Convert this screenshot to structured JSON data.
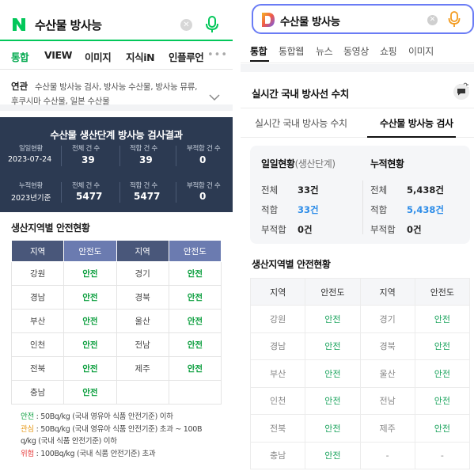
{
  "naver": {
    "search": {
      "query": "수산물 방사능",
      "logo_letter": "N",
      "brand_color": "#03c75a"
    },
    "tabs": [
      "통합",
      "VIEW",
      "이미지",
      "지식iN",
      "인플루언"
    ],
    "related": {
      "label": "연관",
      "line1": "수산물 방사능 검사, 방사능 수산물, 방사능 뮤류,",
      "line2": "후쿠시마 수산물, 일본 수산물"
    },
    "summary": {
      "title": "수산물 생산단계 방사능 검사결과",
      "daily": {
        "label": "일일현황",
        "date": "2023-07-24",
        "total_label": "전체 건 수",
        "total": "39",
        "ok_label": "적합 건 수",
        "ok": "39",
        "fail_label": "부적합 건 수",
        "fail": "0"
      },
      "cumulative": {
        "label": "누적현황",
        "basis": "2023년기준",
        "total_label": "전체 건 수",
        "total": "5477",
        "ok_label": "적합 건 수",
        "ok": "5477",
        "fail_label": "부적합 건 수",
        "fail": "0"
      }
    },
    "region_title": "생산지역별 안전현황",
    "table": {
      "headers": [
        "지역",
        "안전도",
        "지역",
        "안전도"
      ],
      "rows": [
        [
          "강원",
          "안전",
          "경기",
          "안전"
        ],
        [
          "경남",
          "안전",
          "경북",
          "안전"
        ],
        [
          "부산",
          "안전",
          "울산",
          "안전"
        ],
        [
          "인천",
          "안전",
          "전남",
          "안전"
        ],
        [
          "전북",
          "안전",
          "제주",
          "안전"
        ],
        [
          "충남",
          "안전",
          "",
          ""
        ]
      ]
    },
    "legend": {
      "safe_label": "안전",
      "safe_text": " : 50Bq/kg (국내 영유아 식품 안전기준) 이하",
      "warn_label": "관심",
      "warn_text": " : 50Bq/kg (국내 영유아 식품 안전기준) 초과 ~ 100B",
      "warn_text2": "q/kg (국내 식품 안전기준) 이하",
      "danger_label": "위험",
      "danger_text": " : 100Bq/kg (국내 식품 안전기준) 초과"
    }
  },
  "daum": {
    "search": {
      "query": "수산물 방사능",
      "logo_letter": "D"
    },
    "tabs": [
      "통합",
      "통합웹",
      "뉴스",
      "동영상",
      "쇼핑",
      "이미지"
    ],
    "card_title": "실시간 국내 방사선 수치",
    "subtabs": [
      "실시간 국내 방사능 수치",
      "수산물 방사능 검사"
    ],
    "daily": {
      "title": "일일현황",
      "title_sub": "(생산단계)",
      "total_label": "전체",
      "total": "33건",
      "ok_label": "적합",
      "ok": "33건",
      "fail_label": "부적합",
      "fail": "0건"
    },
    "cumulative": {
      "title": "누적현황",
      "total_label": "전체",
      "total": "5,438건",
      "ok_label": "적합",
      "ok": "5,438건",
      "fail_label": "부적합",
      "fail": "0건"
    },
    "region_title": "생산지역별 안전현황",
    "table": {
      "headers": [
        "지역",
        "안전도",
        "지역",
        "안전도"
      ],
      "rows": [
        [
          "강원",
          "안전",
          "경기",
          "안전"
        ],
        [
          "경남",
          "안전",
          "경북",
          "안전"
        ],
        [
          "부산",
          "안전",
          "울산",
          "안전"
        ],
        [
          "인천",
          "안전",
          "전남",
          "안전"
        ],
        [
          "전북",
          "안전",
          "제주",
          "안전"
        ],
        [
          "충남",
          "안전",
          "-",
          "-"
        ]
      ]
    }
  }
}
